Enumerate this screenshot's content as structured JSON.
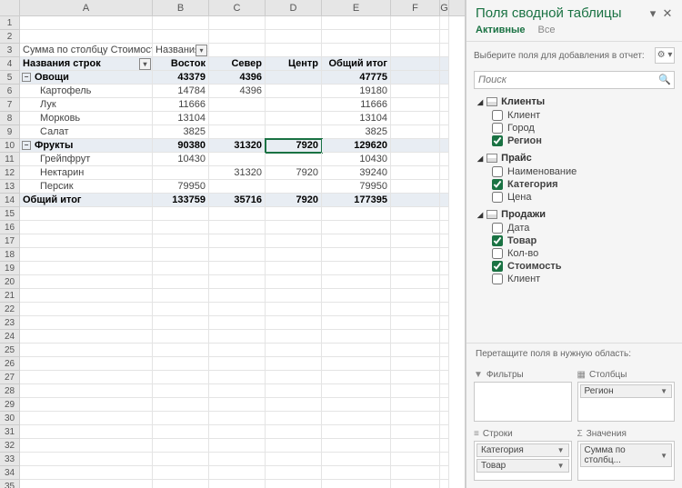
{
  "columns": [
    "A",
    "B",
    "C",
    "D",
    "E",
    "F",
    "G"
  ],
  "rowCount": 35,
  "cells": {
    "r3": {
      "A": "Сумма по столбцу Стоимость",
      "B": "Названия с"
    },
    "r4": {
      "A": "Названия строк",
      "B": "Восток",
      "C": "Север",
      "D": "Центр",
      "E": "Общий итог"
    },
    "r5": {
      "A": "Овощи",
      "B": "43379",
      "C": "4396",
      "E": "47775"
    },
    "r6": {
      "A": "Картофель",
      "B": "14784",
      "C": "4396",
      "E": "19180"
    },
    "r7": {
      "A": "Лук",
      "B": "11666",
      "E": "11666"
    },
    "r8": {
      "A": "Морковь",
      "B": "13104",
      "E": "13104"
    },
    "r9": {
      "A": "Салат",
      "B": "3825",
      "E": "3825"
    },
    "r10": {
      "A": "Фрукты",
      "B": "90380",
      "C": "31320",
      "D": "7920",
      "E": "129620"
    },
    "r11": {
      "A": "Грейпфрут",
      "B": "10430",
      "E": "10430"
    },
    "r12": {
      "A": "Нектарин",
      "C": "31320",
      "D": "7920",
      "E": "39240"
    },
    "r13": {
      "A": "Персик",
      "B": "79950",
      "E": "79950"
    },
    "r14": {
      "A": "Общий итог",
      "B": "133759",
      "C": "35716",
      "D": "7920",
      "E": "177395"
    }
  },
  "selectedCell": "D10",
  "pane": {
    "title": "Поля сводной таблицы",
    "tabs": {
      "active": "Активные",
      "all": "Все"
    },
    "instruction": "Выберите поля для добавления в отчет:",
    "searchPlaceholder": "Поиск",
    "groups": [
      {
        "name": "Клиенты",
        "fields": [
          {
            "label": "Клиент",
            "checked": false
          },
          {
            "label": "Город",
            "checked": false
          },
          {
            "label": "Регион",
            "checked": true
          }
        ]
      },
      {
        "name": "Прайс",
        "fields": [
          {
            "label": "Наименование",
            "checked": false
          },
          {
            "label": "Категория",
            "checked": true
          },
          {
            "label": "Цена",
            "checked": false
          }
        ]
      },
      {
        "name": "Продажи",
        "fields": [
          {
            "label": "Дата",
            "checked": false
          },
          {
            "label": "Товар",
            "checked": true
          },
          {
            "label": "Кол-во",
            "checked": false
          },
          {
            "label": "Стоимость",
            "checked": true
          },
          {
            "label": "Клиент",
            "checked": false
          }
        ]
      }
    ],
    "dragText": "Перетащите поля в нужную область:",
    "zones": {
      "filters": {
        "label": "Фильтры",
        "items": []
      },
      "columns": {
        "label": "Столбцы",
        "items": [
          "Регион"
        ]
      },
      "rows": {
        "label": "Строки",
        "items": [
          "Категория",
          "Товар"
        ]
      },
      "values": {
        "label": "Значения",
        "items": [
          "Сумма по столбц..."
        ]
      }
    }
  }
}
